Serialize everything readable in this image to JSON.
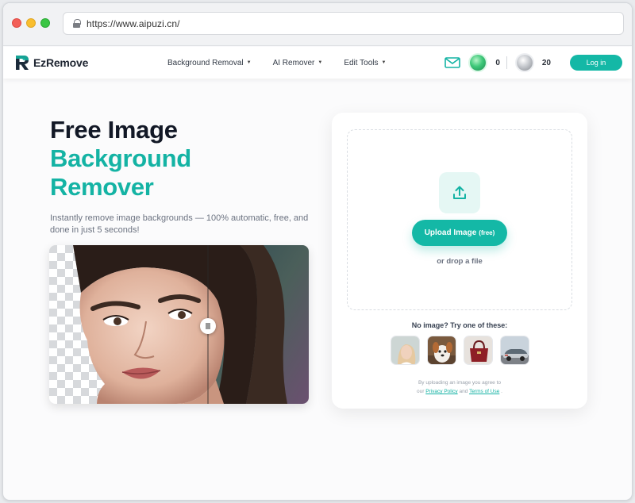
{
  "browser": {
    "url": "https://www.aipuzi.cn/"
  },
  "nav": {
    "brand": "EzRemove",
    "menu": [
      {
        "label": "Background Removal"
      },
      {
        "label": "AI Remover"
      },
      {
        "label": "Edit Tools"
      }
    ],
    "credits_green": "0",
    "credits_silver": "20",
    "login_label": "Log in"
  },
  "hero": {
    "title_line1": "Free Image",
    "title_line2": "Background",
    "title_line3": "Remover",
    "subtitle": "Instantly remove image backgrounds — 100% automatic, free, and done in just 5 seconds!"
  },
  "upload": {
    "button_label": "Upload Image",
    "button_suffix": "(free)",
    "drop_text": "or drop a file",
    "samples_label": "No image? Try one of these:",
    "terms_prefix": "By uploading an image you agree to",
    "terms_our": "our",
    "privacy_link": "Privacy Policy",
    "and_text": "and",
    "terms_link": "Terms of Use",
    "terms_end": "."
  },
  "colors": {
    "accent": "#14b8a6",
    "title_dark": "#121826",
    "title_teal": "#14b3a4"
  },
  "icons": {
    "lock": "lock-icon",
    "mail": "mail-icon",
    "upload": "upload-icon",
    "caret": "caret-down-icon"
  }
}
